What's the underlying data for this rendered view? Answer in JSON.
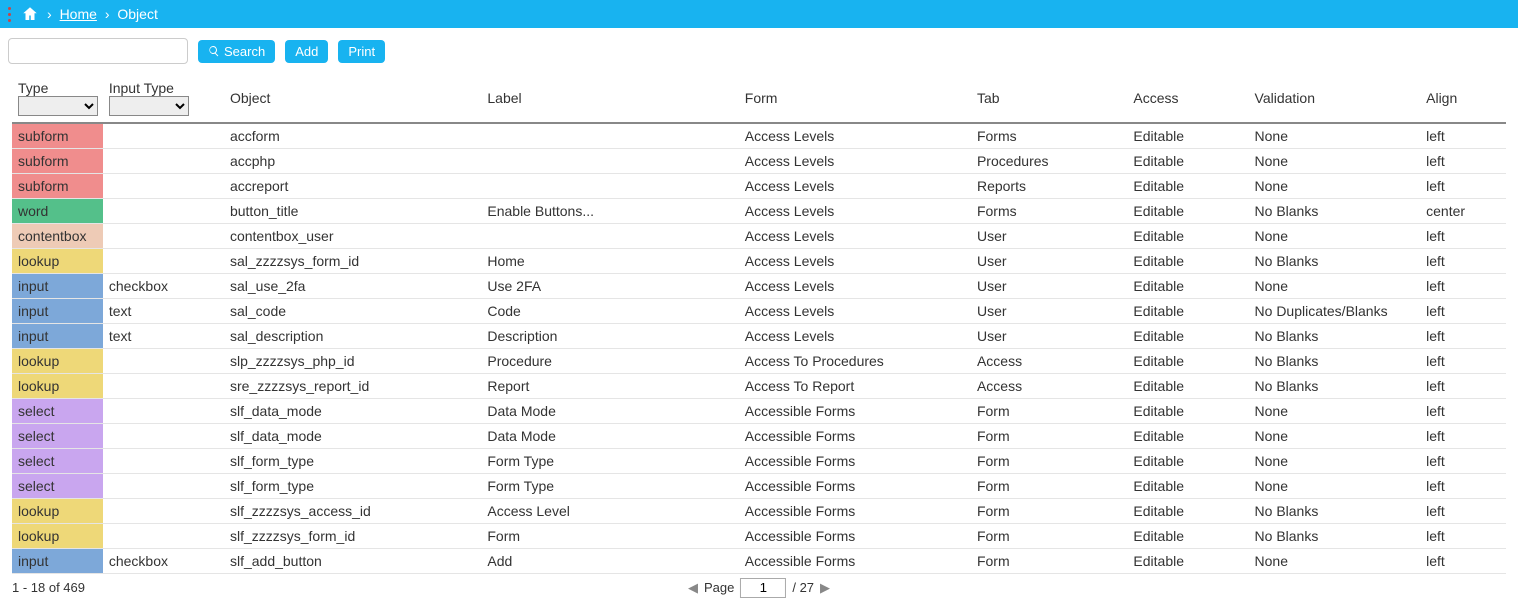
{
  "breadcrumb": {
    "home": "Home",
    "current": "Object"
  },
  "toolbar": {
    "search": "Search",
    "add": "Add",
    "print": "Print"
  },
  "headers": {
    "type": "Type",
    "input_type": "Input Type",
    "object": "Object",
    "label": "Label",
    "form": "Form",
    "tab": "Tab",
    "access": "Access",
    "validation": "Validation",
    "align": "Align"
  },
  "rows": [
    {
      "type": "subform",
      "type_class": "t-subform",
      "input_type": "",
      "object": "accform",
      "label": "",
      "form": "Access Levels",
      "tab": "Forms",
      "access": "Editable",
      "validation": "None",
      "align": "left"
    },
    {
      "type": "subform",
      "type_class": "t-subform",
      "input_type": "",
      "object": "accphp",
      "label": "",
      "form": "Access Levels",
      "tab": "Procedures",
      "access": "Editable",
      "validation": "None",
      "align": "left"
    },
    {
      "type": "subform",
      "type_class": "t-subform",
      "input_type": "",
      "object": "accreport",
      "label": "",
      "form": "Access Levels",
      "tab": "Reports",
      "access": "Editable",
      "validation": "None",
      "align": "left"
    },
    {
      "type": "word",
      "type_class": "t-word",
      "input_type": "",
      "object": "button_title",
      "label": "Enable Buttons...",
      "form": "Access Levels",
      "tab": "Forms",
      "access": "Editable",
      "validation": "No Blanks",
      "align": "center"
    },
    {
      "type": "contentbox",
      "type_class": "t-contentbox",
      "input_type": "",
      "object": "contentbox_user",
      "label": "",
      "form": "Access Levels",
      "tab": "User",
      "access": "Editable",
      "validation": "None",
      "align": "left"
    },
    {
      "type": "lookup",
      "type_class": "t-lookup",
      "input_type": "",
      "object": "sal_zzzzsys_form_id",
      "label": "Home",
      "form": "Access Levels",
      "tab": "User",
      "access": "Editable",
      "validation": "No Blanks",
      "align": "left"
    },
    {
      "type": "input",
      "type_class": "t-input",
      "input_type": "checkbox",
      "object": "sal_use_2fa",
      "label": "Use 2FA",
      "form": "Access Levels",
      "tab": "User",
      "access": "Editable",
      "validation": "None",
      "align": "left"
    },
    {
      "type": "input",
      "type_class": "t-input",
      "input_type": "text",
      "object": "sal_code",
      "label": "Code",
      "form": "Access Levels",
      "tab": "User",
      "access": "Editable",
      "validation": "No Duplicates/Blanks",
      "align": "left"
    },
    {
      "type": "input",
      "type_class": "t-input",
      "input_type": "text",
      "object": "sal_description",
      "label": "Description",
      "form": "Access Levels",
      "tab": "User",
      "access": "Editable",
      "validation": "No Blanks",
      "align": "left"
    },
    {
      "type": "lookup",
      "type_class": "t-lookup",
      "input_type": "",
      "object": "slp_zzzzsys_php_id",
      "label": "Procedure",
      "form": "Access To Procedures",
      "tab": "Access",
      "access": "Editable",
      "validation": "No Blanks",
      "align": "left"
    },
    {
      "type": "lookup",
      "type_class": "t-lookup",
      "input_type": "",
      "object": "sre_zzzzsys_report_id",
      "label": "Report",
      "form": "Access To Report",
      "tab": "Access",
      "access": "Editable",
      "validation": "No Blanks",
      "align": "left"
    },
    {
      "type": "select",
      "type_class": "t-select",
      "input_type": "",
      "object": "slf_data_mode",
      "label": "Data Mode",
      "form": "Accessible Forms",
      "tab": "Form",
      "access": "Editable",
      "validation": "None",
      "align": "left"
    },
    {
      "type": "select",
      "type_class": "t-select",
      "input_type": "",
      "object": "slf_data_mode",
      "label": "Data Mode",
      "form": "Accessible Forms",
      "tab": "Form",
      "access": "Editable",
      "validation": "None",
      "align": "left"
    },
    {
      "type": "select",
      "type_class": "t-select",
      "input_type": "",
      "object": "slf_form_type",
      "label": "Form Type",
      "form": "Accessible Forms",
      "tab": "Form",
      "access": "Editable",
      "validation": "None",
      "align": "left"
    },
    {
      "type": "select",
      "type_class": "t-select",
      "input_type": "",
      "object": "slf_form_type",
      "label": "Form Type",
      "form": "Accessible Forms",
      "tab": "Form",
      "access": "Editable",
      "validation": "None",
      "align": "left"
    },
    {
      "type": "lookup",
      "type_class": "t-lookup",
      "input_type": "",
      "object": "slf_zzzzsys_access_id",
      "label": "Access Level",
      "form": "Accessible Forms",
      "tab": "Form",
      "access": "Editable",
      "validation": "No Blanks",
      "align": "left"
    },
    {
      "type": "lookup",
      "type_class": "t-lookup",
      "input_type": "",
      "object": "slf_zzzzsys_form_id",
      "label": "Form",
      "form": "Accessible Forms",
      "tab": "Form",
      "access": "Editable",
      "validation": "No Blanks",
      "align": "left"
    },
    {
      "type": "input",
      "type_class": "t-input",
      "input_type": "checkbox",
      "object": "slf_add_button",
      "label": "Add",
      "form": "Accessible Forms",
      "tab": "Form",
      "access": "Editable",
      "validation": "None",
      "align": "left"
    }
  ],
  "pager": {
    "range": "1 - 18 of 469",
    "page_label": "Page",
    "current_page": "1",
    "total_pages": "/ 27"
  }
}
